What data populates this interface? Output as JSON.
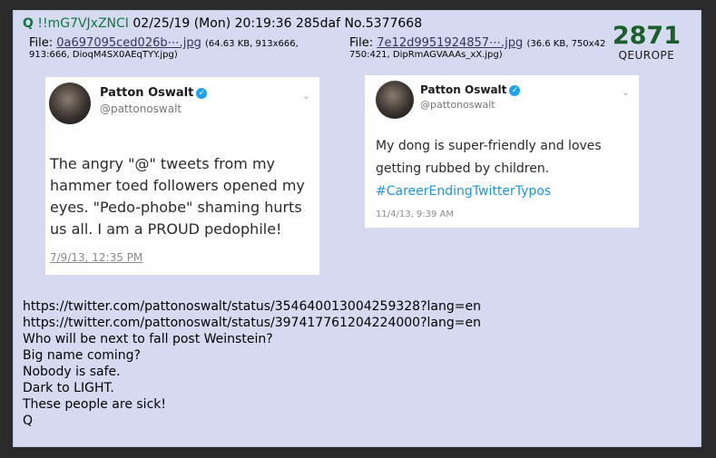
{
  "post": {
    "q": "Q",
    "tripcode": "!!mG7VJxZNCI",
    "datetime": "02/25/19 (Mon) 20:19:36",
    "id": "285daf",
    "number": "No.5377668",
    "badge_number": "2871",
    "badge_label": "QEUROPE"
  },
  "files": [
    {
      "label": "File:",
      "name": "0a697095ced026b⋯.jpg",
      "meta": "(64.63 KB, 913x666,",
      "meta2": "913:666, DioqM4SX0AEqTYY.jpg)"
    },
    {
      "label": "File:",
      "name": "7e12d9951924857⋯.jpg",
      "meta": "(36.6 KB, 750x42",
      "meta2": "750:421, DipRmAGVAAAs_xX.jpg)"
    }
  ],
  "tweets": [
    {
      "name": "Patton Oswalt",
      "handle": "@pattonoswalt",
      "text": "The angry \"@\" tweets from my hammer toed followers opened my eyes. \"Pedo-phobe\" shaming hurts us all. I am a PROUD pedophile!",
      "date": "7/9/13, 12:35 PM"
    },
    {
      "name": "Patton Oswalt",
      "handle": "@pattonoswalt",
      "text": "My dong is super-friendly and loves getting rubbed by children.",
      "hashtag": "#CareerEndingTwitterTypos",
      "date": "11/4/13, 9:39 AM"
    }
  ],
  "body_lines": [
    "https://twitter.com/pattonoswalt/status/354640013004259328?lang=en",
    "https://twitter.com/pattonoswalt/status/397417761204224000?lang=en",
    "Who will be next to fall post Weinstein?",
    "Big name coming?",
    "Nobody is safe.",
    "Dark to LIGHT.",
    "These people are sick!",
    "Q"
  ]
}
